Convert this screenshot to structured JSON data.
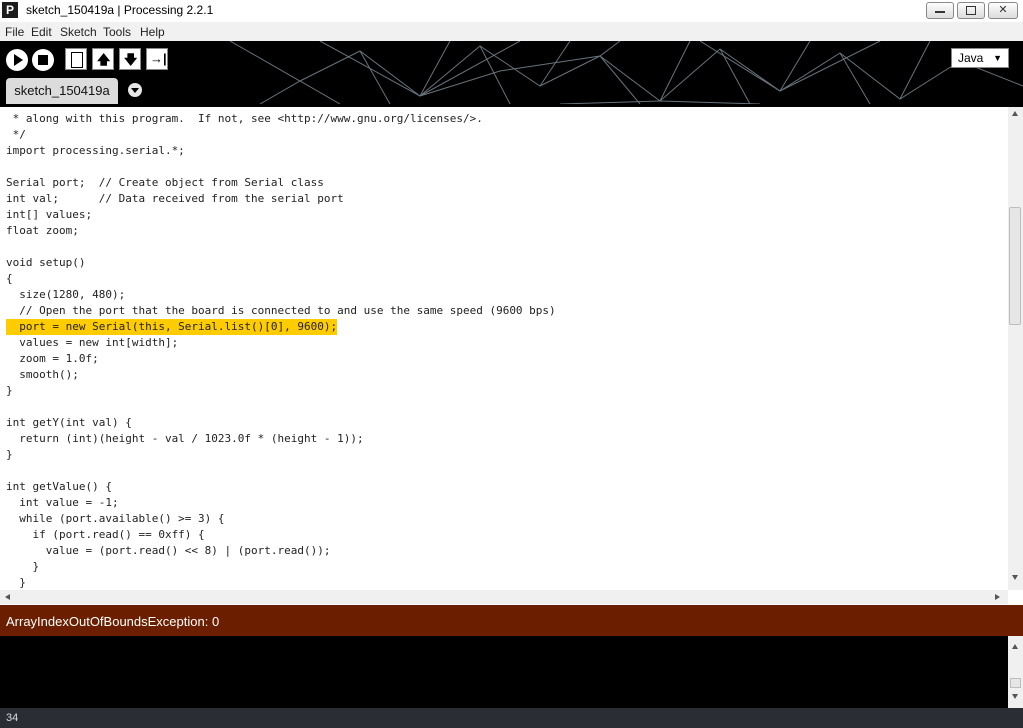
{
  "window": {
    "title": "sketch_150419a | Processing 2.2.1",
    "icon_label": "P"
  },
  "menu": [
    "File",
    "Edit",
    "Sketch",
    "Tools",
    "Help"
  ],
  "toolbar": {
    "mode": "Java",
    "mode_arrow": "▼"
  },
  "tab": {
    "name": "sketch_150419a"
  },
  "code_lines": [
    " * along with this program.  If not, see <http://www.gnu.org/licenses/>.",
    " */",
    "import processing.serial.*;",
    "",
    "Serial port;  // Create object from Serial class",
    "int val;      // Data received from the serial port",
    "int[] values;",
    "float zoom;",
    "",
    "void setup()",
    "{",
    "  size(1280, 480);",
    "  // Open the port that the board is connected to and use the same speed (9600 bps)",
    "  port = new Serial(this, Serial.list()[0], 9600);",
    "  values = new int[width];",
    "  zoom = 1.0f;",
    "  smooth();",
    "}",
    "",
    "int getY(int val) {",
    "  return (int)(height - val / 1023.0f * (height - 1));",
    "}",
    "",
    "int getValue() {",
    "  int value = -1;",
    "  while (port.available() >= 3) {",
    "    if (port.read() == 0xff) {",
    "      value = (port.read() << 8) | (port.read());",
    "    }",
    "  }"
  ],
  "highlighted_line": 13,
  "status": {
    "message": "ArrayIndexOutOfBoundsException: 0",
    "color": "#6b1f00"
  },
  "footer": {
    "line_number": "34"
  },
  "colors": {
    "highlight": "#ffcc00",
    "comment": "#666666",
    "keyword": "#33997e"
  }
}
